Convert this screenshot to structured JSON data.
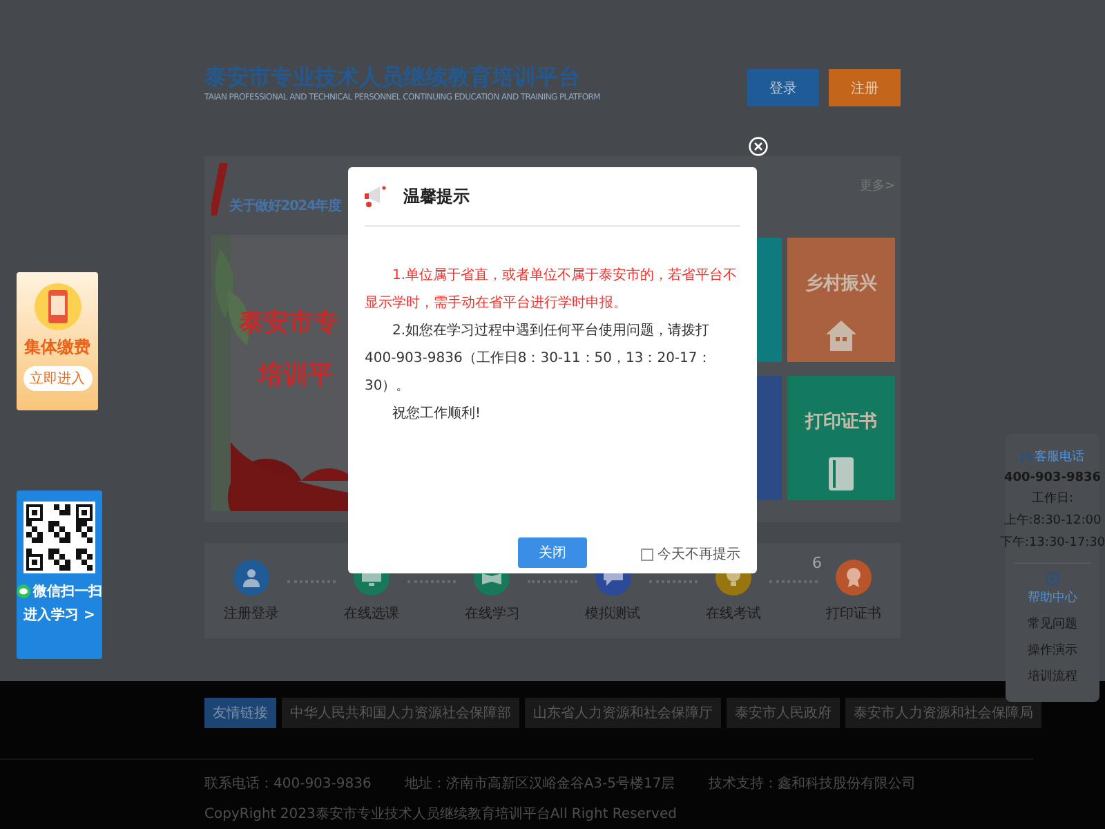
{
  "header": {
    "title": "泰安市专业技术人员继续教育培训平台",
    "subtitle": "TAIAN PROFESSIONAL AND TECHNICAL PERSONNEL CONTINUING EDUCATION AND TRAINING PLATFORM",
    "buttons": [
      {
        "label": "登录",
        "kind": "login"
      },
      {
        "label": "注册",
        "kind": "register"
      }
    ]
  },
  "news": {
    "headline": "关于做好2024年度",
    "more": "更多>"
  },
  "banner": {
    "lines": [
      "泰安市专",
      "培训平"
    ]
  },
  "tiles": [
    {
      "color": "#0e7c7e"
    },
    {
      "label": "乡村振兴",
      "color": "#a9613f"
    },
    {
      "color": "#2b4a86"
    },
    {
      "label": "打印证书",
      "color": "#137a5f"
    }
  ],
  "steps": [
    {
      "label": "注册登录",
      "color": "#1f5c97"
    },
    {
      "label": "在线选课",
      "color": "#17785a"
    },
    {
      "label": "在线学习",
      "color": "#17785a"
    },
    {
      "label": "模拟测试",
      "color": "#2b4a9a"
    },
    {
      "label": "在线考试",
      "color": "#98760f"
    },
    {
      "label": "打印证书",
      "color": "#b8552b",
      "number": "6"
    }
  ],
  "left_float": {
    "pay": {
      "title": "集体缴费",
      "button": "立即进入"
    },
    "qr": {
      "lines": [
        "微信扫一扫",
        "进入学习 >"
      ]
    }
  },
  "right_float": {
    "service": {
      "title": "客服电话",
      "phone": "400-903-9836",
      "hours": [
        "工作日:",
        "上午:8:30-12:00",
        "下午:13:30-17:30"
      ]
    },
    "help": {
      "title": "帮助中心",
      "links": [
        "常见问题",
        "操作演示",
        "培训流程"
      ]
    }
  },
  "footer": {
    "links": [
      {
        "label": "友情链接",
        "selected": true
      },
      {
        "label": "中华人民共和国人力资源社会保障部",
        "selected": false
      },
      {
        "label": "山东省人力资源和社会保障厅",
        "selected": false
      },
      {
        "label": "泰安市人民政府",
        "selected": false
      },
      {
        "label": "泰安市人力资源和社会保障局",
        "selected": false
      }
    ],
    "info": [
      "联系电话：400-903-9836",
      "地址：济南市高新区汉峪金谷A3-5号楼17层",
      "技术支持：鑫和科技股份有限公司"
    ],
    "copyright": "CopyRight 2023泰安市专业技术人员继续教育培训平台All Right Reserved"
  },
  "modal": {
    "title": "温馨提示",
    "paragraphs": [
      {
        "kind": "warning",
        "text": "1.单位属于省直，或者单位不属于泰安市的，若省平台不显示学时，需手动在省平台进行学时申报。"
      },
      {
        "kind": "normal",
        "text": "2.如您在学习过程中遇到任何平台使用问题，请拨打400-903-9836（工作日8：30-11：50，13：20-17：30）。"
      },
      {
        "kind": "normal",
        "text": "祝您工作顺利!"
      }
    ],
    "button": "关闭",
    "checkbox": {
      "label": "今天不再提示",
      "checked": false
    }
  }
}
